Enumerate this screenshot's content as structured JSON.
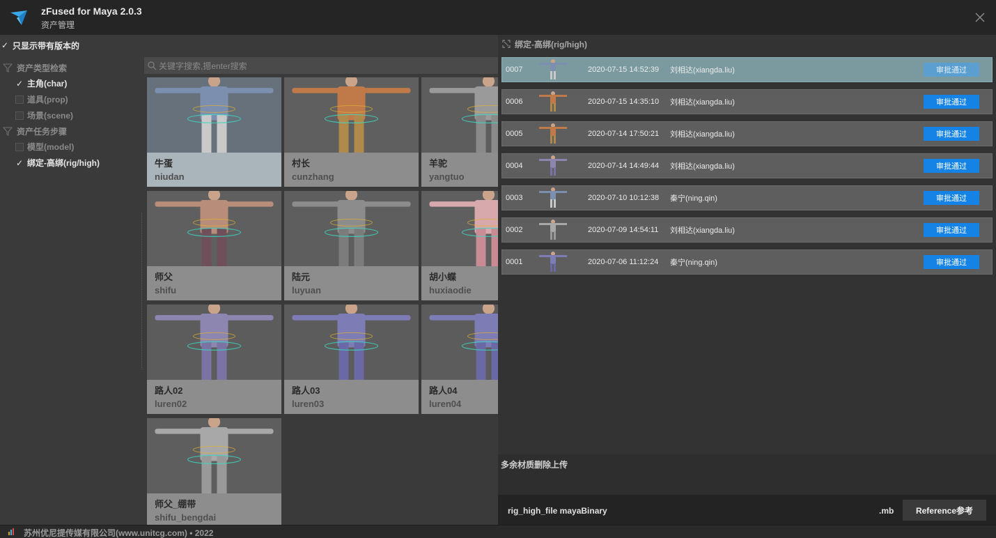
{
  "app": {
    "title": "zFused for Maya 2.0.3",
    "subtitle": "资产管理"
  },
  "filters": {
    "only_versioned": {
      "label": "只显示带有版本的",
      "checked": true
    },
    "groups": [
      {
        "label": "资产类型检索",
        "items": [
          {
            "label": "主角(char)",
            "checked": true
          },
          {
            "label": "道具(prop)",
            "checked": false
          },
          {
            "label": "场景(scene)",
            "checked": false
          }
        ]
      },
      {
        "label": "资产任务步骤",
        "items": [
          {
            "label": "模型(model)",
            "checked": false
          },
          {
            "label": "绑定-高绑(rig/high)",
            "checked": true
          }
        ]
      }
    ]
  },
  "search": {
    "placeholder": "关键字搜索,摁enter搜索"
  },
  "assets": [
    {
      "cn": "牛蛋",
      "en": "niudan",
      "selected": true
    },
    {
      "cn": "村长",
      "en": "cunzhang",
      "selected": false
    },
    {
      "cn": "羊驼",
      "en": "yangtuo",
      "selected": false
    },
    {
      "cn": "师父",
      "en": "shifu",
      "selected": false
    },
    {
      "cn": "陆元",
      "en": "luyuan",
      "selected": false
    },
    {
      "cn": "胡小蝶",
      "en": "huxiaodie",
      "selected": false
    },
    {
      "cn": "路人02",
      "en": "luren02",
      "selected": false
    },
    {
      "cn": "路人03",
      "en": "luren03",
      "selected": false
    },
    {
      "cn": "路人04",
      "en": "luren04",
      "selected": false
    },
    {
      "cn": "师父_绷带",
      "en": "shifu_bengdai",
      "selected": false
    }
  ],
  "versions_panel": {
    "header": "绑定-高绑(rig/high)",
    "approve_label": "审批通过",
    "versions": [
      {
        "num": "0007",
        "time": "2020-07-15 14:52:39",
        "user": "刘相达(xiangda.liu)",
        "active": true
      },
      {
        "num": "0006",
        "time": "2020-07-15 14:35:10",
        "user": "刘相达(xiangda.liu)",
        "active": false
      },
      {
        "num": "0005",
        "time": "2020-07-14 17:50:21",
        "user": "刘相达(xiangda.liu)",
        "active": false
      },
      {
        "num": "0004",
        "time": "2020-07-14 14:49:44",
        "user": "刘相达(xiangda.liu)",
        "active": false
      },
      {
        "num": "0003",
        "time": "2020-07-10 10:12:38",
        "user": "秦宁(ning.qin)",
        "active": false
      },
      {
        "num": "0002",
        "time": "2020-07-09 14:54:11",
        "user": "刘相达(xiangda.liu)",
        "active": false
      },
      {
        "num": "0001",
        "time": "2020-07-06 11:12:24",
        "user": "秦宁(ning.qin)",
        "active": false
      }
    ],
    "description": "多余材质删除上传",
    "file_label": "rig_high_file  mayaBinary",
    "file_ext": ".mb",
    "reference_label": "Reference参考"
  },
  "status": {
    "text": "苏州优尼提传媒有限公司(www.unitcg.com) • 2022"
  },
  "colors": {
    "accent": "#1583e6",
    "active_row": "#7b9aa0"
  }
}
